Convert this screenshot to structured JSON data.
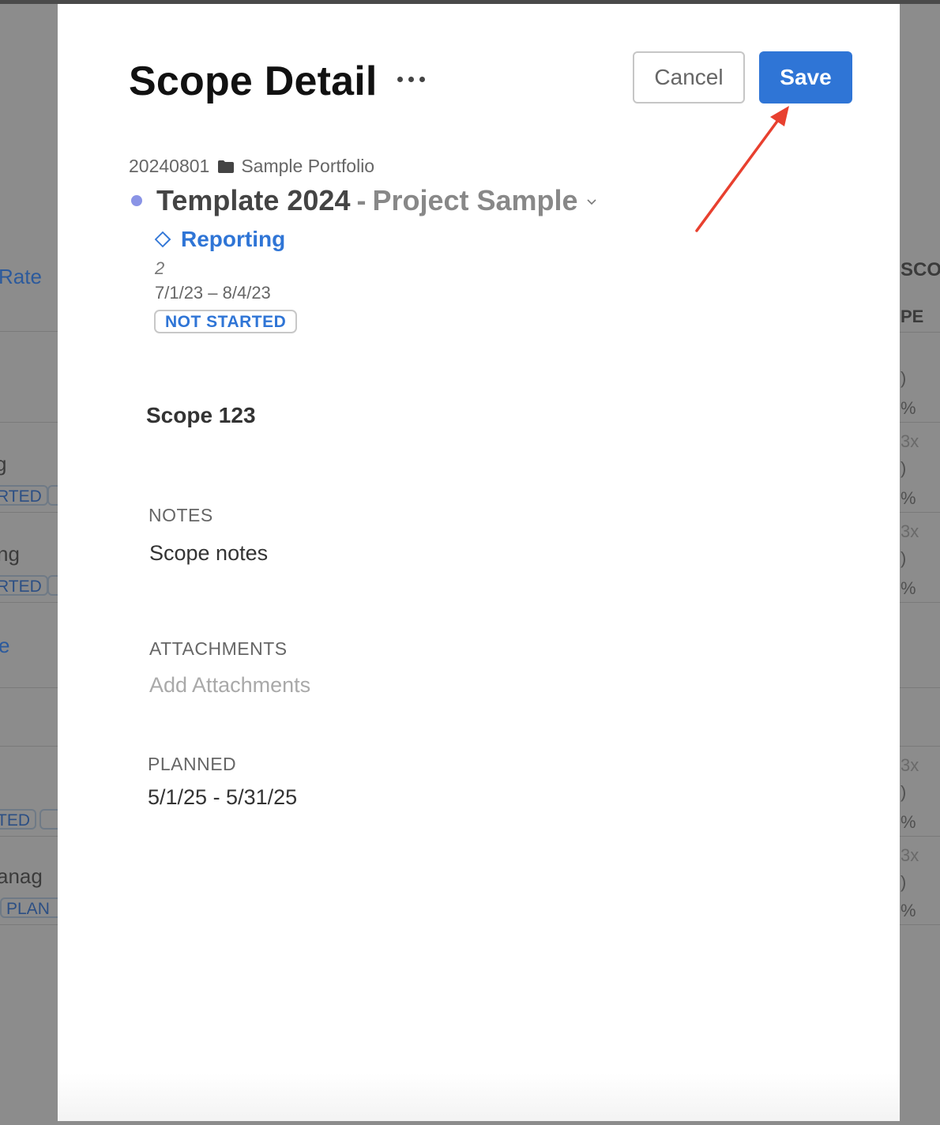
{
  "background": {
    "left_texts": [
      "Rate",
      "g",
      "RTED",
      "ng",
      "RTED",
      "e",
      "TED",
      "anag",
      "PLAN"
    ],
    "right_texts": [
      "SCO",
      "PE",
      ")",
      "%",
      "3x",
      ")",
      "%",
      "3x",
      ")",
      "%",
      "3x",
      ")",
      "%",
      "3x",
      ")",
      "%"
    ]
  },
  "modal": {
    "title": "Scope Detail",
    "cancel_label": "Cancel",
    "save_label": "Save",
    "breadcrumb": {
      "code": "20240801",
      "portfolio": "Sample Portfolio"
    },
    "project": {
      "name": "Template 2024",
      "separator": "-",
      "sub": "Project Sample"
    },
    "phase": {
      "label": "Reporting",
      "number": "2",
      "dates": "7/1/23 – 8/4/23",
      "status": "NOT STARTED"
    },
    "scope_name": "Scope 123",
    "notes": {
      "label": "NOTES",
      "value": "Scope notes"
    },
    "attachments": {
      "label": "ATTACHMENTS",
      "placeholder": "Add Attachments"
    },
    "planned": {
      "label": "PLANNED",
      "value": "5/1/25 - 5/31/25"
    }
  },
  "colors": {
    "accent": "#2f75d6",
    "annotation": "#e8402f",
    "dot": "#8a94e6"
  }
}
